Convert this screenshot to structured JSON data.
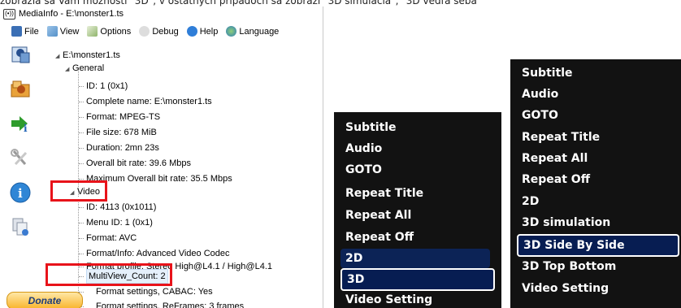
{
  "top_caption": "zobrazia sa Vám možnosti \"3D\", v ostatných prípadoch sa zobrazí \"3D simulácia\", \"3D vedľa seba\"",
  "window": {
    "title": "MediaInfo - E:\\monster1.ts",
    "app_icon_text": "(•))"
  },
  "menu": [
    {
      "label": "File",
      "icon": "file-icon"
    },
    {
      "label": "View",
      "icon": "view-icon"
    },
    {
      "label": "Options",
      "icon": "options-icon"
    },
    {
      "label": "Debug",
      "icon": "debug-icon"
    },
    {
      "label": "Help",
      "icon": "help-icon"
    },
    {
      "label": "Language",
      "icon": "language-icon"
    }
  ],
  "toolbar_icons": [
    "open-file-icon",
    "open-folder-icon",
    "export-icon",
    "preferences-icon",
    "info-icon",
    "copy-icon"
  ],
  "tree": {
    "root": "E:\\monster1.ts",
    "general_label": "General",
    "general": [
      "ID: 1 (0x1)",
      "Complete name: E:\\monster1.ts",
      "Format: MPEG-TS",
      "File size: 678 MiB",
      "Duration: 2mn 23s",
      "Overall bit rate: 39.6 Mbps",
      "Maximum Overall bit rate: 35.5 Mbps"
    ],
    "video_label": "Video",
    "video": [
      "ID: 4113 (0x1011)",
      "Menu ID: 1 (0x1)",
      "Format: AVC",
      "Format/Info: Advanced Video Codec",
      "Format profile: Stereo High@L4.1 / High@L4.1",
      "MultiView_Count: 2",
      "Format settings, CABAC: Yes",
      "Format settings, ReFrames: 3 frames"
    ]
  },
  "donate_label": "Donate",
  "tv_menu_1": {
    "items": [
      "Subtitle",
      "Audio",
      "GOTO",
      "Repeat Title",
      "Repeat All",
      "Repeat Off",
      "2D",
      "3D",
      "Video Setting"
    ],
    "selected": "3D"
  },
  "tv_menu_2": {
    "items": [
      "Subtitle",
      "Audio",
      "GOTO",
      "Repeat Title",
      "Repeat All",
      "Repeat Off",
      "2D",
      "3D simulation",
      "3D Side By Side",
      "3D Top Bottom",
      "Video Setting"
    ],
    "selected": "3D Side By Side"
  },
  "colors": {
    "highlight_red": "#e8131a",
    "tv_background": "#121212",
    "tv_selection_border": "#ffffff",
    "tv_selection_fill": "#071d52"
  }
}
